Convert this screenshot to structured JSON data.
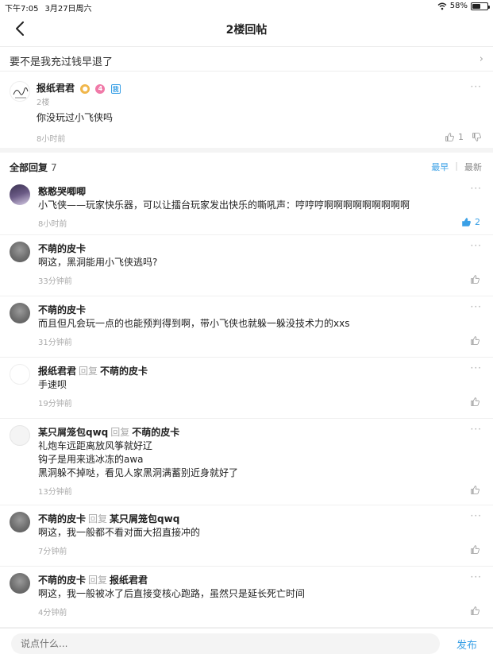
{
  "status": {
    "time": "下午7:05",
    "date": "3月27日周六",
    "battery": "58%",
    "battery_level": 0.58
  },
  "nav": {
    "title": "2楼回帖",
    "back_icon": "chevron-left-icon"
  },
  "thread": {
    "title": "要不是我充过钱早退了",
    "chevron": "›"
  },
  "post": {
    "author": "报纸君君",
    "badges": [
      "●",
      "4",
      "我"
    ],
    "floor": "2楼",
    "text": "你没玩过小飞侠吗",
    "time": "8小时前",
    "likes": "1",
    "more": "···"
  },
  "replies_header": {
    "label": "全部回复",
    "count": "7",
    "sort_first": "最早",
    "sort_sep": "|",
    "sort_latest": "最新"
  },
  "replies": [
    {
      "author": "憨憨哭唧唧",
      "reply_word": "",
      "target": "",
      "lines": [
        "小飞侠——玩家快乐器，可以让擂台玩家发出快乐的嘶吼声：哼哼哼啊啊啊啊啊啊啊啊啊"
      ],
      "time": "8小时前",
      "likes": "2",
      "more": "···"
    },
    {
      "author": "不萌的皮卡",
      "reply_word": "",
      "target": "",
      "lines": [
        "啊这，黑洞能用小飞侠逃吗?"
      ],
      "time": "33分钟前",
      "likes": "",
      "more": "···"
    },
    {
      "author": "不萌的皮卡",
      "reply_word": "",
      "target": "",
      "lines": [
        "而且但凡会玩一点的也能预判得到啊，带小飞侠也就躲一躲没技术力的xxs"
      ],
      "time": "31分钟前",
      "likes": "",
      "more": "···"
    },
    {
      "author": "报纸君君",
      "reply_word": "回复",
      "target": "不萌的皮卡",
      "lines": [
        "手速呗"
      ],
      "time": "19分钟前",
      "likes": "",
      "more": "···"
    },
    {
      "author": "某只屑笼包qwq",
      "reply_word": "回复",
      "target": "不萌的皮卡",
      "lines": [
        "礼炮车远距离放风筝就好辽",
        "钩子是用来逃冰冻的awa",
        "黑洞躲不掉哒，看见人家黑洞满蓄别近身就好了"
      ],
      "time": "13分钟前",
      "likes": "",
      "more": "···"
    },
    {
      "author": "不萌的皮卡",
      "reply_word": "回复",
      "target": "某只屑笼包qwq",
      "lines": [
        "啊这，我一般都不看对面大招直接冲的"
      ],
      "time": "7分钟前",
      "likes": "",
      "more": "···"
    },
    {
      "author": "不萌的皮卡",
      "reply_word": "回复",
      "target": "报纸君君",
      "lines": [
        "啊这，我一般被冰了后直接变核心跑路，虽然只是延长死亡时间"
      ],
      "time": "4分钟前",
      "likes": "",
      "more": "···"
    }
  ],
  "composer": {
    "placeholder": "说点什么...",
    "send": "发布"
  },
  "colors": {
    "accent": "#3aa0e6",
    "muted": "#aaaaaa"
  }
}
